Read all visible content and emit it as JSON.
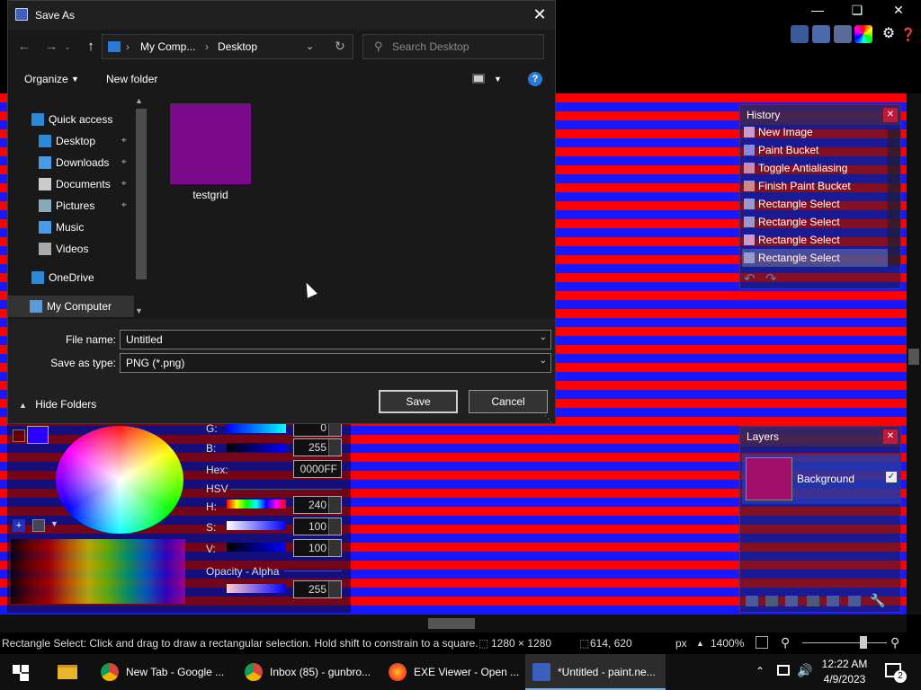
{
  "app": {
    "title_suffix": "*Untitled - paint.net",
    "status": {
      "message": "Rectangle Select: Click and drag to draw a rectangular selection. Hold shift to constrain to a square.",
      "image_size": "1280 × 1280",
      "cursor_pos": "614, 620",
      "units": "px",
      "zoom": "1400%"
    },
    "history": {
      "title": "History",
      "items": [
        "New Image",
        "Paint Bucket",
        "Toggle Antialiasing",
        "Finish Paint Bucket",
        "Rectangle Select",
        "Rectangle Select",
        "Rectangle Select",
        "Rectangle Select"
      ]
    },
    "layers": {
      "title": "Layers",
      "layer_name": "Background"
    },
    "colors": {
      "g_label": "G:",
      "g_value": "0",
      "b_label": "B:",
      "b_value": "255",
      "hex_label": "Hex:",
      "hex_value": "0000FF",
      "hsv_label": "HSV",
      "h_label": "H:",
      "h_value": "240",
      "s_label": "S:",
      "s_value": "100",
      "v_label": "V:",
      "v_value": "100",
      "opacity_label": "Opacity - Alpha",
      "alpha_value": "255"
    }
  },
  "dialog": {
    "title": "Save As",
    "breadcrumb": [
      "My Comp...",
      "Desktop"
    ],
    "search_placeholder": "Search Desktop",
    "organize_label": "Organize",
    "new_folder_label": "New folder",
    "nav_items": [
      {
        "label": "Quick access",
        "icon": "star-icon"
      },
      {
        "label": "Desktop",
        "icon": "desktop-icon",
        "pinned": true
      },
      {
        "label": "Downloads",
        "icon": "download-icon",
        "pinned": true
      },
      {
        "label": "Documents",
        "icon": "document-icon",
        "pinned": true
      },
      {
        "label": "Pictures",
        "icon": "pictures-icon",
        "pinned": true
      },
      {
        "label": "Music",
        "icon": "music-icon"
      },
      {
        "label": "Videos",
        "icon": "videos-icon"
      },
      {
        "label": "OneDrive",
        "icon": "cloud-icon"
      },
      {
        "label": "My Computer",
        "icon": "computer-icon"
      }
    ],
    "files": [
      {
        "name": "testgrid"
      }
    ],
    "file_name_label": "File name:",
    "file_name_value": "Untitled",
    "save_type_label": "Save as type:",
    "save_type_value": "PNG (*.png)",
    "hide_folders_label": "Hide Folders",
    "save_label": "Save",
    "cancel_label": "Cancel"
  },
  "taskbar": {
    "items": [
      {
        "label": "New Tab - Google ...",
        "icon": "chrome-icon"
      },
      {
        "label": "Inbox (85) - gunbro...",
        "icon": "chrome-icon"
      },
      {
        "label": "EXE Viewer - Open ...",
        "icon": "firefox-icon"
      },
      {
        "label": "*Untitled - paint.ne...",
        "icon": "paintnet-icon",
        "active": true
      }
    ],
    "time": "12:22 AM",
    "date": "4/9/2023",
    "notification_count": "2"
  },
  "colors": {
    "canvas_red": "#ff0000",
    "canvas_blue": "#1818ff",
    "thumb_purple": "#7a0a8a",
    "dialog_bg": "#191919",
    "accent": "#0078d7"
  }
}
